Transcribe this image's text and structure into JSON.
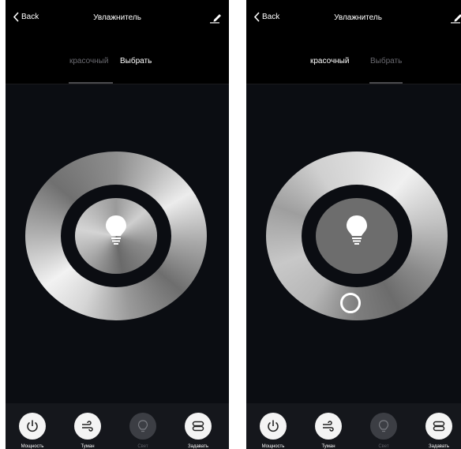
{
  "screens": [
    {
      "nav": {
        "back_label": "Back",
        "title": "Увлажнитель"
      },
      "tabs": {
        "colorful": "красочный",
        "select": "Выбрать",
        "active": "select"
      },
      "wheel": {
        "color_knob_visible": false
      },
      "bottom_bar": [
        {
          "label": "Мощность",
          "icon": "power-icon",
          "active": true
        },
        {
          "label": "Туман",
          "icon": "mist-icon",
          "active": true
        },
        {
          "label": "Свет",
          "icon": "light-bulb-icon",
          "active": false
        },
        {
          "label": "Задавать",
          "icon": "settings-icon",
          "active": true
        }
      ]
    },
    {
      "nav": {
        "back_label": "Back",
        "title": "Увлажнитель"
      },
      "tabs": {
        "colorful": "красочный",
        "select": "Выбрать",
        "active": "colorful"
      },
      "wheel": {
        "color_knob_visible": true
      },
      "bottom_bar": [
        {
          "label": "Мощность",
          "icon": "power-icon",
          "active": true
        },
        {
          "label": "Туман",
          "icon": "mist-icon",
          "active": true
        },
        {
          "label": "Свет",
          "icon": "light-bulb-icon",
          "active": false
        },
        {
          "label": "Задавать",
          "icon": "settings-icon",
          "active": true
        }
      ]
    }
  ],
  "colors": {
    "background": "#000000",
    "content_background": "#0b0d12",
    "bottom_bar": "#15171c",
    "active_tab_text": "#ffffff",
    "inactive_tab_text": "#6a6a70",
    "ring_light": "#d9d9d9",
    "ring_dark": "#4f4f4f",
    "button_on": "#f4f4f4",
    "button_off": "#3c3e44"
  }
}
